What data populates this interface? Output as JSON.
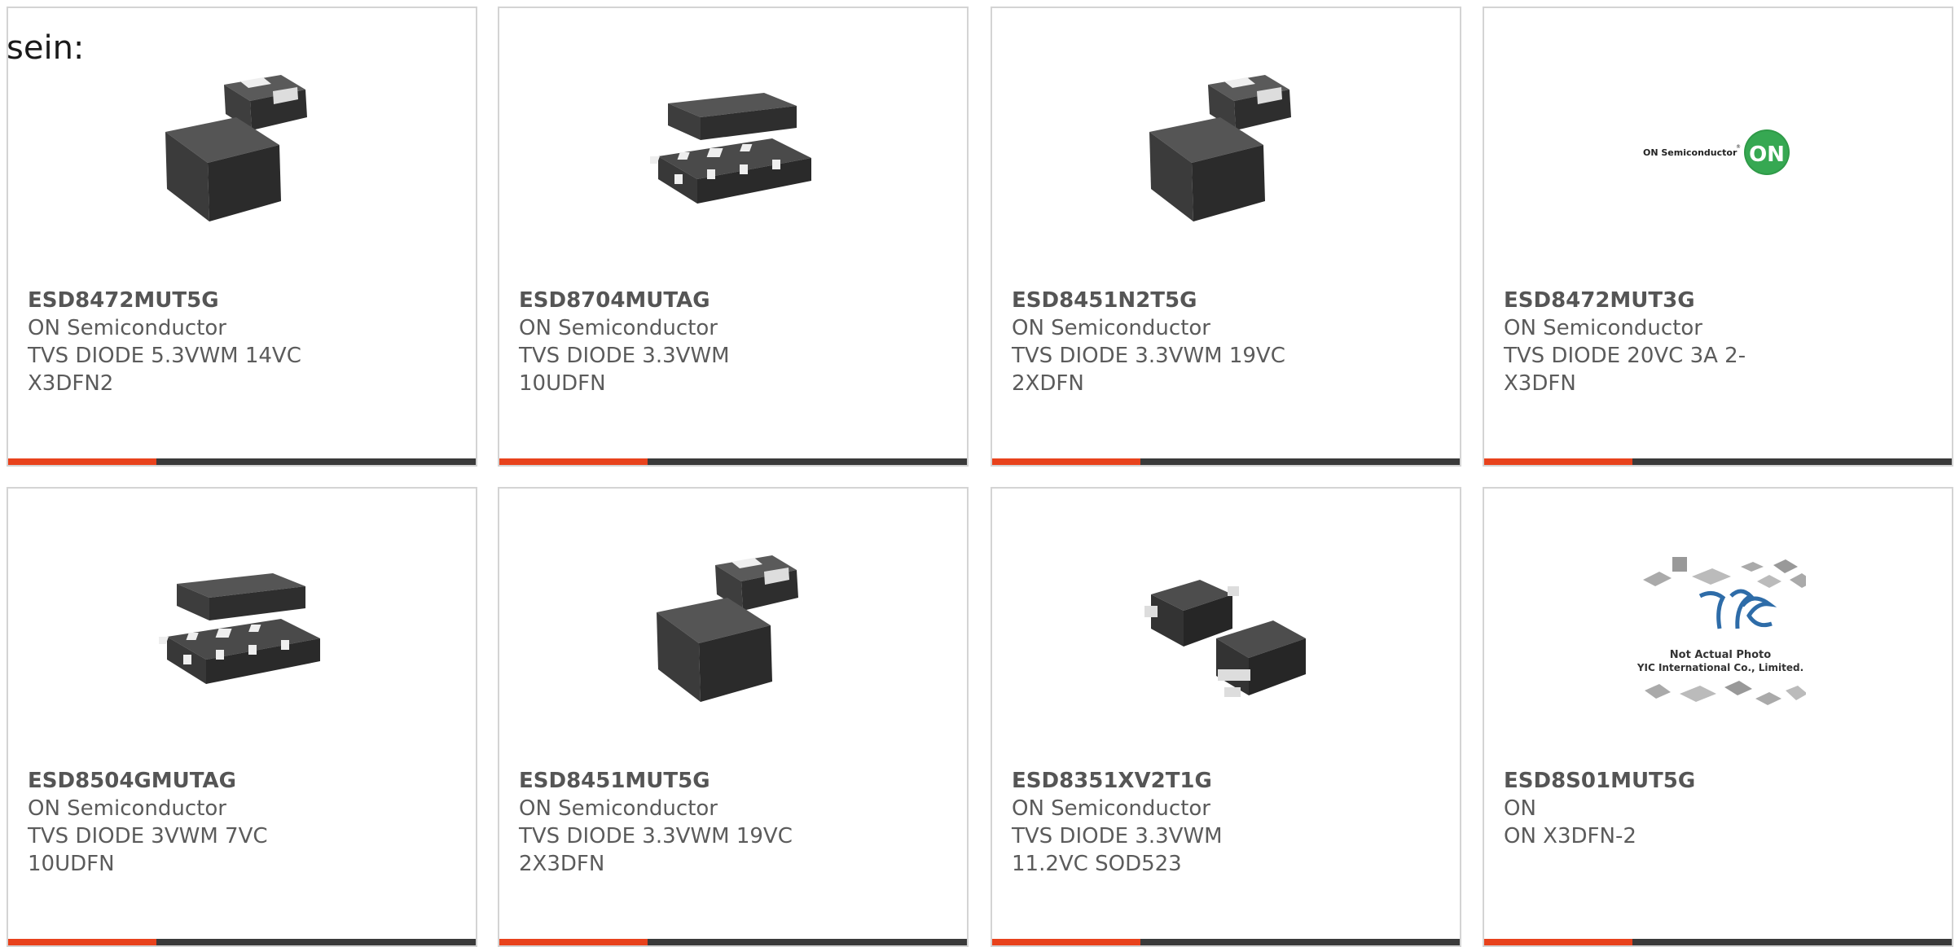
{
  "intro_text": "sein:",
  "colors": {
    "accent": "#e8421c",
    "bar": "#3a3a3a",
    "border": "#d4d4d4"
  },
  "products": [
    {
      "part": "ESD8472MUT5G",
      "manufacturer": "ON Semiconductor",
      "description": "TVS DIODE 5.3VWM 14VC X3DFN2",
      "image": "two-chip-package-icon"
    },
    {
      "part": "ESD8704MUTAG",
      "manufacturer": "ON Semiconductor",
      "description": "TVS DIODE 3.3VWM 10UDFN",
      "image": "udfn-package-icon"
    },
    {
      "part": "ESD8451N2T5G",
      "manufacturer": "ON Semiconductor",
      "description": "TVS DIODE 3.3VWM 19VC 2XDFN",
      "image": "two-chip-package-icon"
    },
    {
      "part": "ESD8472MUT3G",
      "manufacturer": "ON Semiconductor",
      "description": "TVS DIODE 20VC 3A 2-X3DFN",
      "image": "on-semiconductor-logo",
      "logo_text": "ON Semiconductor",
      "logo_mark": "ON"
    },
    {
      "part": "ESD8504GMUTAG",
      "manufacturer": "ON Semiconductor",
      "description": "TVS DIODE 3VWM 7VC 10UDFN",
      "image": "udfn-package-icon"
    },
    {
      "part": "ESD8451MUT5G",
      "manufacturer": "ON Semiconductor",
      "description": "TVS DIODE 3.3VWM 19VC 2X3DFN",
      "image": "two-chip-package-icon"
    },
    {
      "part": "ESD8351XV2T1G",
      "manufacturer": "ON Semiconductor",
      "description": "TVS DIODE 3.3VWM 11.2VC SOD523",
      "image": "sod523-package-icon"
    },
    {
      "part": "ESD8S01MUT5G",
      "manufacturer": "ON",
      "description": "ON X3DFN-2",
      "image": "yic-placeholder-image",
      "logo_mark": "YIC",
      "placeholder_lines": [
        "Not Actual Photo",
        "YIC International Co., Limited."
      ]
    }
  ]
}
